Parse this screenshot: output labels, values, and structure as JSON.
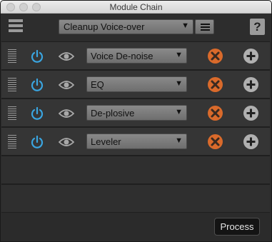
{
  "window": {
    "title": "Module Chain"
  },
  "toolbar": {
    "menu_icon": "hamburger-icon",
    "preset": {
      "value": "Cleanup Voice-over",
      "arrow": "▼"
    },
    "preset_list_icon": "list-icon",
    "help_label": "?"
  },
  "modules": [
    {
      "name": "Voice De-noise",
      "arrow": "▼"
    },
    {
      "name": "EQ",
      "arrow": "▼"
    },
    {
      "name": "De-plosive",
      "arrow": "▼"
    },
    {
      "name": "Leveler",
      "arrow": "▼"
    }
  ],
  "footer": {
    "process_label": "Process"
  },
  "colors": {
    "power_blue": "#3aa5e0",
    "remove_orange": "#d96a2b",
    "add_gray": "#b0b0b0"
  }
}
